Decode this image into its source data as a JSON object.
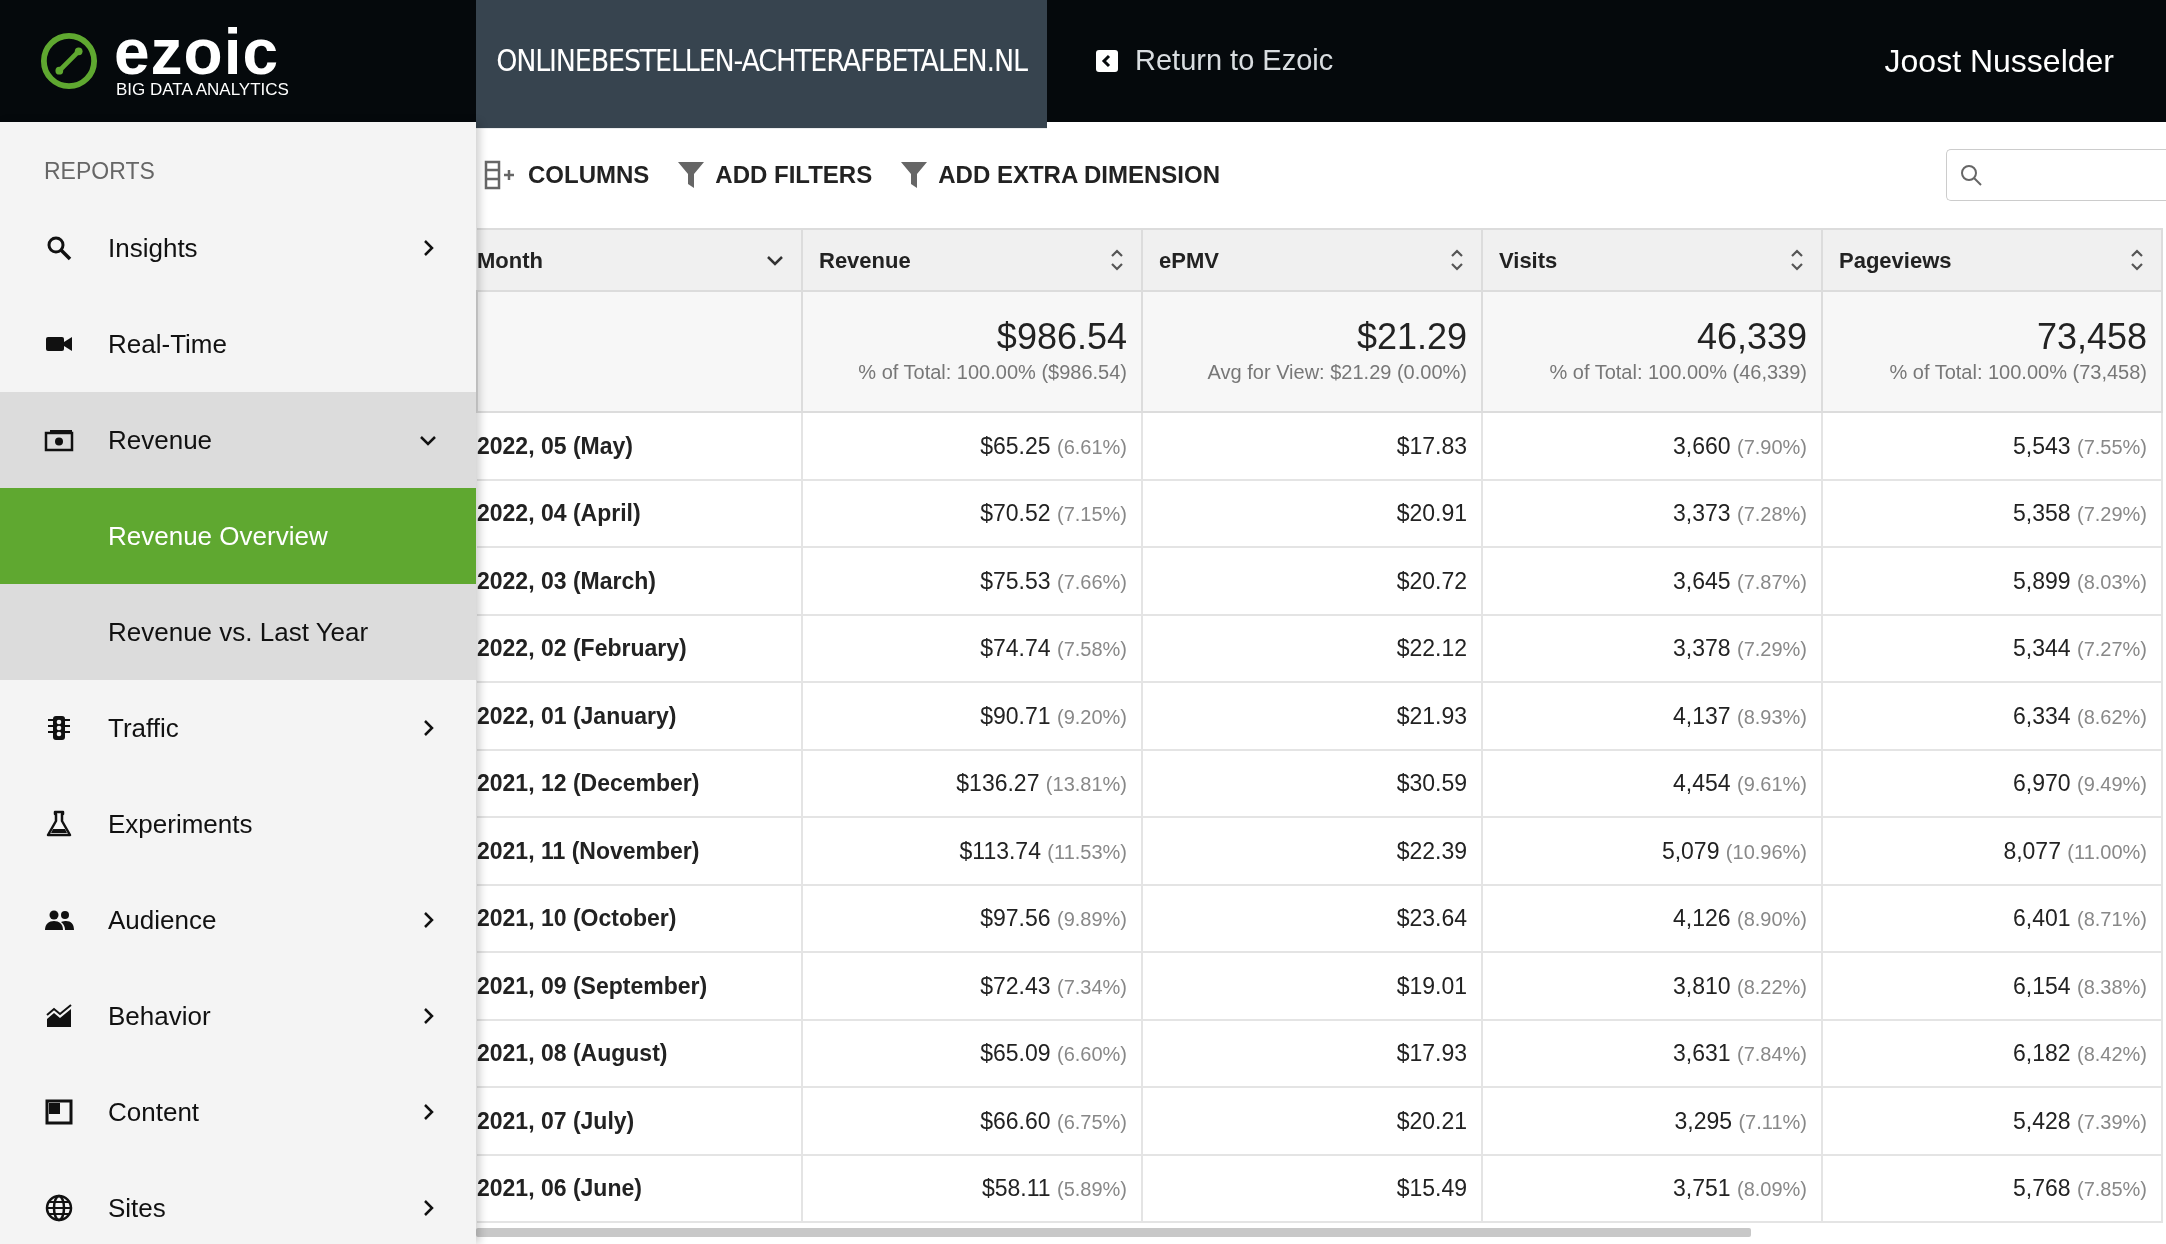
{
  "header": {
    "logo": {
      "wordmark": "ezoic",
      "tagline": "BIG DATA ANALYTICS"
    },
    "site": "ONLINEBESTELLEN-ACHTERAFBETALEN.NL",
    "return_link": "Return to Ezoic",
    "user": "Joost Nusselder"
  },
  "sidebar": {
    "section": "REPORTS",
    "items": [
      {
        "label": "Insights",
        "kind": "group",
        "expanded": false,
        "selected": false
      },
      {
        "label": "Real-Time",
        "kind": "link",
        "selected": false
      },
      {
        "label": "Revenue",
        "kind": "group",
        "expanded": true,
        "selected": true,
        "children": [
          {
            "label": "Revenue Overview",
            "selected": true
          },
          {
            "label": "Revenue vs. Last Year",
            "selected": false
          }
        ]
      },
      {
        "label": "Traffic",
        "kind": "group",
        "expanded": false,
        "selected": false
      },
      {
        "label": "Experiments",
        "kind": "link",
        "selected": false
      },
      {
        "label": "Audience",
        "kind": "group",
        "expanded": false,
        "selected": false
      },
      {
        "label": "Behavior",
        "kind": "group",
        "expanded": false,
        "selected": false
      },
      {
        "label": "Content",
        "kind": "group",
        "expanded": false,
        "selected": false
      },
      {
        "label": "Sites",
        "kind": "group",
        "expanded": false,
        "selected": false
      }
    ]
  },
  "toolbar": {
    "buttons": [
      "COLUMNS",
      "ADD FILTERS",
      "ADD EXTRA DIMENSION"
    ]
  },
  "table": {
    "columns": [
      {
        "label": "Month",
        "kind": "dropdown"
      },
      {
        "label": "Revenue",
        "kind": "sortable"
      },
      {
        "label": "ePMV",
        "kind": "sortable"
      },
      {
        "label": "Visits",
        "kind": "sortable"
      },
      {
        "label": "Pageviews",
        "kind": "sortable"
      }
    ],
    "totals": [
      {
        "value": "$986.54",
        "note": "% of Total: 100.00% ($986.54)"
      },
      {
        "value": "$21.29",
        "note": "Avg for View: $21.29 (0.00%)"
      },
      {
        "value": "46,339",
        "note": "% of Total: 100.00% (46,339)"
      },
      {
        "value": "73,458",
        "note": "% of Total: 100.00% (73,458)"
      }
    ],
    "rows": [
      {
        "cells": [
          {
            "value": "2022, 05 (May)"
          },
          {
            "value": "$65.25",
            "share": "(6.61%)"
          },
          {
            "value": "$17.83"
          },
          {
            "value": "3,660",
            "share": "(7.90%)"
          },
          {
            "value": "5,543",
            "share": "(7.55%)"
          }
        ]
      },
      {
        "cells": [
          {
            "value": "2022, 04 (April)"
          },
          {
            "value": "$70.52",
            "share": "(7.15%)"
          },
          {
            "value": "$20.91"
          },
          {
            "value": "3,373",
            "share": "(7.28%)"
          },
          {
            "value": "5,358",
            "share": "(7.29%)"
          }
        ]
      },
      {
        "cells": [
          {
            "value": "2022, 03 (March)"
          },
          {
            "value": "$75.53",
            "share": "(7.66%)"
          },
          {
            "value": "$20.72"
          },
          {
            "value": "3,645",
            "share": "(7.87%)"
          },
          {
            "value": "5,899",
            "share": "(8.03%)"
          }
        ]
      },
      {
        "cells": [
          {
            "value": "2022, 02 (February)"
          },
          {
            "value": "$74.74",
            "share": "(7.58%)"
          },
          {
            "value": "$22.12"
          },
          {
            "value": "3,378",
            "share": "(7.29%)"
          },
          {
            "value": "5,344",
            "share": "(7.27%)"
          }
        ]
      },
      {
        "cells": [
          {
            "value": "2022, 01 (January)"
          },
          {
            "value": "$90.71",
            "share": "(9.20%)"
          },
          {
            "value": "$21.93"
          },
          {
            "value": "4,137",
            "share": "(8.93%)"
          },
          {
            "value": "6,334",
            "share": "(8.62%)"
          }
        ]
      },
      {
        "cells": [
          {
            "value": "2021, 12 (December)"
          },
          {
            "value": "$136.27",
            "share": "(13.81%)"
          },
          {
            "value": "$30.59"
          },
          {
            "value": "4,454",
            "share": "(9.61%)"
          },
          {
            "value": "6,970",
            "share": "(9.49%)"
          }
        ]
      },
      {
        "cells": [
          {
            "value": "2021, 11 (November)"
          },
          {
            "value": "$113.74",
            "share": "(11.53%)"
          },
          {
            "value": "$22.39"
          },
          {
            "value": "5,079",
            "share": "(10.96%)"
          },
          {
            "value": "8,077",
            "share": "(11.00%)"
          }
        ]
      },
      {
        "cells": [
          {
            "value": "2021, 10 (October)"
          },
          {
            "value": "$97.56",
            "share": "(9.89%)"
          },
          {
            "value": "$23.64"
          },
          {
            "value": "4,126",
            "share": "(8.90%)"
          },
          {
            "value": "6,401",
            "share": "(8.71%)"
          }
        ]
      },
      {
        "cells": [
          {
            "value": "2021, 09 (September)"
          },
          {
            "value": "$72.43",
            "share": "(7.34%)"
          },
          {
            "value": "$19.01"
          },
          {
            "value": "3,810",
            "share": "(8.22%)"
          },
          {
            "value": "6,154",
            "share": "(8.38%)"
          }
        ]
      },
      {
        "cells": [
          {
            "value": "2021, 08 (August)"
          },
          {
            "value": "$65.09",
            "share": "(6.60%)"
          },
          {
            "value": "$17.93"
          },
          {
            "value": "3,631",
            "share": "(7.84%)"
          },
          {
            "value": "6,182",
            "share": "(8.42%)"
          }
        ]
      },
      {
        "cells": [
          {
            "value": "2021, 07 (July)"
          },
          {
            "value": "$66.60",
            "share": "(6.75%)"
          },
          {
            "value": "$20.21"
          },
          {
            "value": "3,295",
            "share": "(7.11%)"
          },
          {
            "value": "5,428",
            "share": "(7.39%)"
          }
        ]
      },
      {
        "cells": [
          {
            "value": "2021, 06 (June)"
          },
          {
            "value": "$58.11",
            "share": "(5.89%)"
          },
          {
            "value": "$15.49"
          },
          {
            "value": "3,751",
            "share": "(8.09%)"
          },
          {
            "value": "5,768",
            "share": "(7.85%)"
          }
        ]
      }
    ]
  }
}
